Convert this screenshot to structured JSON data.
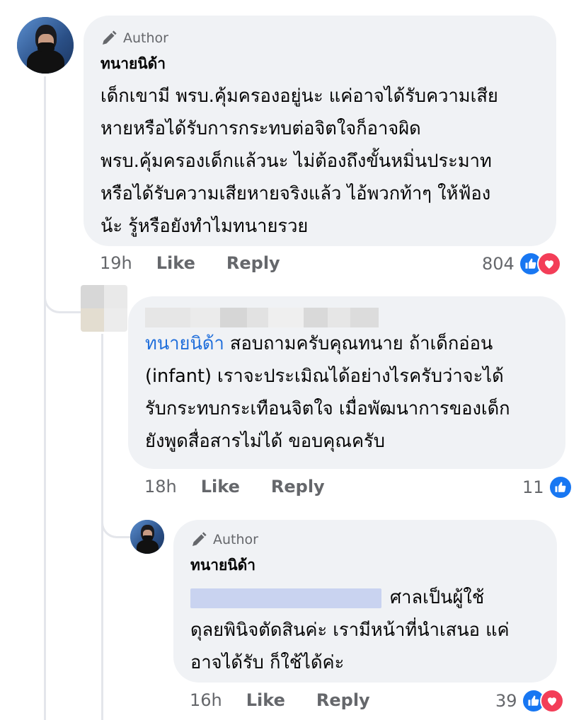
{
  "comment1": {
    "author_badge": "Author",
    "name": "ทนายนิด้า",
    "text": "เด็กเขามี พรบ.คุ้มครองอยู่นะ แค่อาจได้รับความเสีย\nหายหรือได้รับการกระทบต่อจิตใจก็อาจผิด\nพรบ.คุ้มครองเด็กแล้วนะ ไม่ต้องถึงขั้นหมิ่นประมาท\nหรือได้รับความเสียหายจริงแล้ว ไอ้พวกท้าๆ ให้ฟ้อง\nน้ะ รู้หรือยังทำไมทนายรวย",
    "time": "19h",
    "like": "Like",
    "reply": "Reply",
    "reaction_count": "804",
    "reactions": [
      "like-icon",
      "love-icon"
    ]
  },
  "comment2": {
    "mention": "ทนายนิด้า",
    "text": "สอบถามครับคุณทนาย ถ้าเด็กอ่อน\n(infant) เราจะประเมิณได้อย่างไรครับว่าจะได้\nรับกระทบกระเทือนจิตใจ เมื่อพัฒนาการของเด็ก\nยังพูดสื่อสารไม่ได้ ขอบคุณครับ",
    "time": "18h",
    "like": "Like",
    "reply": "Reply",
    "reaction_count": "11",
    "reactions": [
      "like-icon"
    ]
  },
  "comment3": {
    "author_badge": "Author",
    "name": "ทนายนิด้า",
    "text_first": "ศาลเป็นผู้ใช้",
    "text_rest": "ดุลยพินิจตัดสินค่ะ เรามีหน้าที่นำเสนอ แค่\nอาจได้รับ ก็ใช้ได้ค่ะ",
    "time": "16h",
    "like": "Like",
    "reply": "Reply",
    "reaction_count": "39",
    "reactions": [
      "like-icon",
      "love-icon"
    ]
  },
  "colors": {
    "bubble": "#f0f2f5",
    "mention": "#216fdb",
    "meta": "#65676b",
    "like": "#1877f2",
    "love": "#f33e58"
  }
}
